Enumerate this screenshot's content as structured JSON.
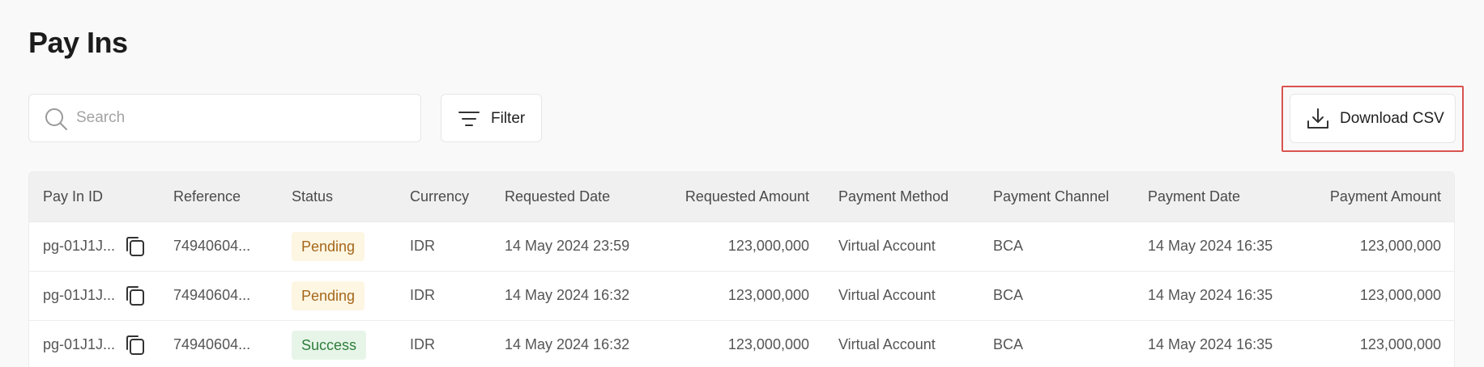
{
  "page": {
    "title": "Pay Ins"
  },
  "toolbar": {
    "search_placeholder": "Search",
    "filter_label": "Filter",
    "download_label": "Download CSV"
  },
  "table": {
    "columns": [
      "Pay In ID",
      "Reference",
      "Status",
      "Currency",
      "Requested Date",
      "Requested Amount",
      "Payment Method",
      "Payment Channel",
      "Payment Date",
      "Payment Amount"
    ],
    "rows": [
      {
        "id": "pg-01J1J...",
        "reference": "74940604...",
        "status": "Pending",
        "currency": "IDR",
        "requested_date": "14 May 2024 23:59",
        "requested_amount": "123,000,000",
        "payment_method": "Virtual Account",
        "payment_channel": "BCA",
        "payment_date": "14 May 2024 16:35",
        "payment_amount": "123,000,000"
      },
      {
        "id": "pg-01J1J...",
        "reference": "74940604...",
        "status": "Pending",
        "currency": "IDR",
        "requested_date": "14 May 2024 16:32",
        "requested_amount": "123,000,000",
        "payment_method": "Virtual Account",
        "payment_channel": "BCA",
        "payment_date": "14 May 2024 16:35",
        "payment_amount": "123,000,000"
      },
      {
        "id": "pg-01J1J...",
        "reference": "74940604...",
        "status": "Success",
        "currency": "IDR",
        "requested_date": "14 May 2024 16:32",
        "requested_amount": "123,000,000",
        "payment_method": "Virtual Account",
        "payment_channel": "BCA",
        "payment_date": "14 May 2024 16:35",
        "payment_amount": "123,000,000"
      }
    ]
  },
  "colors": {
    "highlight": "#d9534f",
    "pending_text": "#a5671a",
    "pending_bg": "#fdf6e3",
    "success_text": "#2e7d3a",
    "success_bg": "#e7f5e9"
  },
  "icons": {
    "search": "search-icon",
    "filter": "filter-icon",
    "download": "download-icon",
    "copy": "copy-icon"
  }
}
